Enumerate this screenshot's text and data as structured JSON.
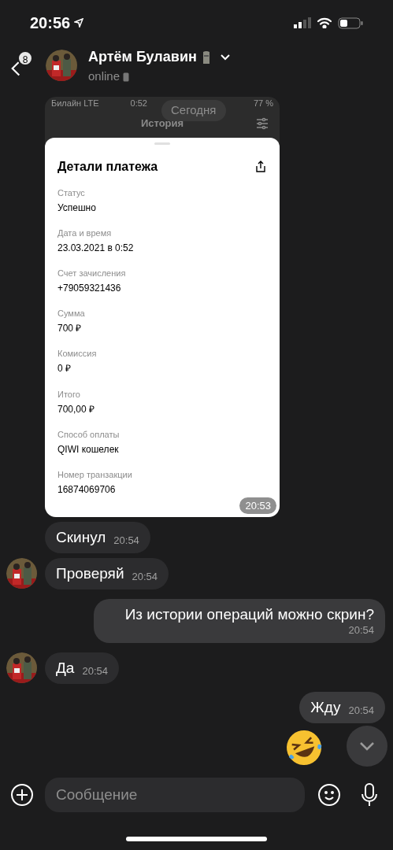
{
  "status_bar": {
    "time": "20:56"
  },
  "header": {
    "back_badge": "8",
    "name": "Артём Булавин",
    "status": "online"
  },
  "messages": [
    {
      "kind": "screenshot",
      "date_pill": "Сегодня",
      "inner_status": {
        "carrier": "Билайн LTE",
        "time": "0:52",
        "battery": "77 %"
      },
      "inner_title": "История",
      "sheet_title": "Детали платежа",
      "fields": [
        {
          "label": "Статус",
          "value": "Успешно"
        },
        {
          "label": "Дата и время",
          "value": "23.03.2021 в 0:52"
        },
        {
          "label": "Счет зачисления",
          "value": "+79059321436"
        },
        {
          "label": "Сумма",
          "value": "700 ₽"
        },
        {
          "label": "Комиссия",
          "value": "0 ₽"
        },
        {
          "label": "Итого",
          "value": "700,00 ₽"
        },
        {
          "label": "Способ оплаты",
          "value": "QIWI кошелек"
        },
        {
          "label": "Номер транзакции",
          "value": "16874069706"
        }
      ],
      "time": "20:53",
      "outgoing": false,
      "avatar": false
    },
    {
      "kind": "text",
      "text": "Скинул",
      "time": "20:54",
      "outgoing": false,
      "avatar": false
    },
    {
      "kind": "text",
      "text": "Проверяй",
      "time": "20:54",
      "outgoing": false,
      "avatar": true
    },
    {
      "kind": "text",
      "text": "Из истории операций можно скрин?",
      "time": "20:54",
      "outgoing": true
    },
    {
      "kind": "text",
      "text": "Да",
      "time": "20:54",
      "outgoing": false,
      "avatar": true
    },
    {
      "kind": "text",
      "text": "Жду",
      "time": "20:54",
      "outgoing": true
    },
    {
      "kind": "emoji",
      "outgoing": true
    }
  ],
  "composer": {
    "placeholder": "Сообщение"
  }
}
